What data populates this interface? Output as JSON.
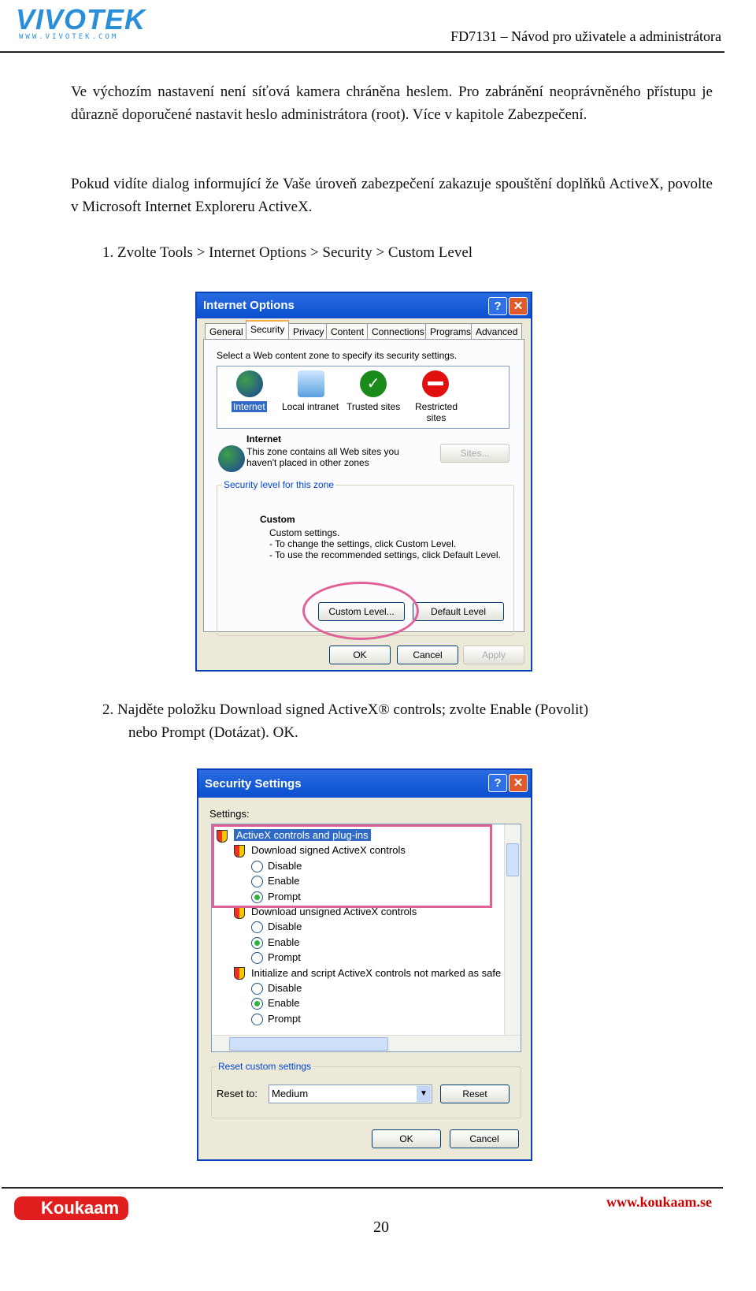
{
  "header": {
    "logo_text": "VIVOTEK",
    "logo_url_text": "WWW.VIVOTEK.COM",
    "title": "FD7131 – Návod pro uživatele a administrátora"
  },
  "body": {
    "para1": "Ve výchozím nastavení není síťová kamera chráněna heslem. Pro zabránění neoprávněného přístupu je důrazně doporučené nastavit heslo administrátora (root). Více v kapitole Zabezpečení.",
    "para2": "Pokud vidíte dialog informující že Vaše úroveň zabezpečení zakazuje spouštění doplňků ActiveX, povolte v Microsoft Internet Exploreru ActiveX.",
    "step1": "1.  Zvolte Tools > Internet Options > Security > Custom Level",
    "step2a": "2.  Najděte položku  Download signed ActiveX® controls; zvolte Enable (Povolit)",
    "step2b": "nebo Prompt (Dotázat). OK."
  },
  "internet_options": {
    "title": "Internet Options",
    "help": "?",
    "close": "✕",
    "tabs": [
      "General",
      "Security",
      "Privacy",
      "Content",
      "Connections",
      "Programs",
      "Advanced"
    ],
    "active_tab": "Security",
    "zone_prompt": "Select a Web content zone to specify its security settings.",
    "zones": [
      {
        "label": "Internet",
        "icon": "globe-icon",
        "selected": true
      },
      {
        "label": "Local intranet",
        "icon": "intranet-icon"
      },
      {
        "label": "Trusted sites",
        "icon": "check-icon",
        "color": "#1a8a1a"
      },
      {
        "label": "Restricted sites",
        "icon": "no-entry-icon",
        "color": "#e01010"
      }
    ],
    "zone_name": "Internet",
    "zone_desc1": "This zone contains all Web sites you",
    "zone_desc2": "haven't placed in other zones",
    "sites_button": "Sites...",
    "level_group": "Security level for this zone",
    "level_name": "Custom",
    "level_lines": [
      "Custom settings.",
      "- To change the settings, click Custom Level.",
      "- To use the recommended settings, click Default Level."
    ],
    "custom_level_button": "Custom Level...",
    "default_level_button": "Default Level",
    "ok": "OK",
    "cancel": "Cancel",
    "apply": "Apply",
    "highlight_color": "#e0609a"
  },
  "security_settings": {
    "title": "Security Settings",
    "help": "?",
    "close": "✕",
    "settings_label": "Settings:",
    "rows": [
      {
        "type": "category",
        "label": "ActiveX controls and plug-ins"
      },
      {
        "type": "item",
        "label": "Download signed ActiveX controls"
      },
      {
        "type": "radio",
        "label": "Disable",
        "checked": false
      },
      {
        "type": "radio",
        "label": "Enable",
        "checked": false
      },
      {
        "type": "radio",
        "label": "Prompt",
        "checked": true
      },
      {
        "type": "item",
        "label": "Download unsigned ActiveX controls"
      },
      {
        "type": "radio",
        "label": "Disable",
        "checked": false
      },
      {
        "type": "radio",
        "label": "Enable",
        "checked": true
      },
      {
        "type": "radio",
        "label": "Prompt",
        "checked": false
      },
      {
        "type": "item",
        "label": "Initialize and script ActiveX controls not marked as safe"
      },
      {
        "type": "radio",
        "label": "Disable",
        "checked": false
      },
      {
        "type": "radio",
        "label": "Enable",
        "checked": true
      },
      {
        "type": "radio",
        "label": "Prompt",
        "checked": false
      }
    ],
    "reset_group": "Reset custom settings",
    "reset_to_label": "Reset to:",
    "reset_to_value": "Medium",
    "reset_button": "Reset",
    "ok": "OK",
    "cancel": "Cancel"
  },
  "footer": {
    "logo_text": "Koukaam",
    "url": "www.koukaam.se",
    "page_number": "20"
  }
}
